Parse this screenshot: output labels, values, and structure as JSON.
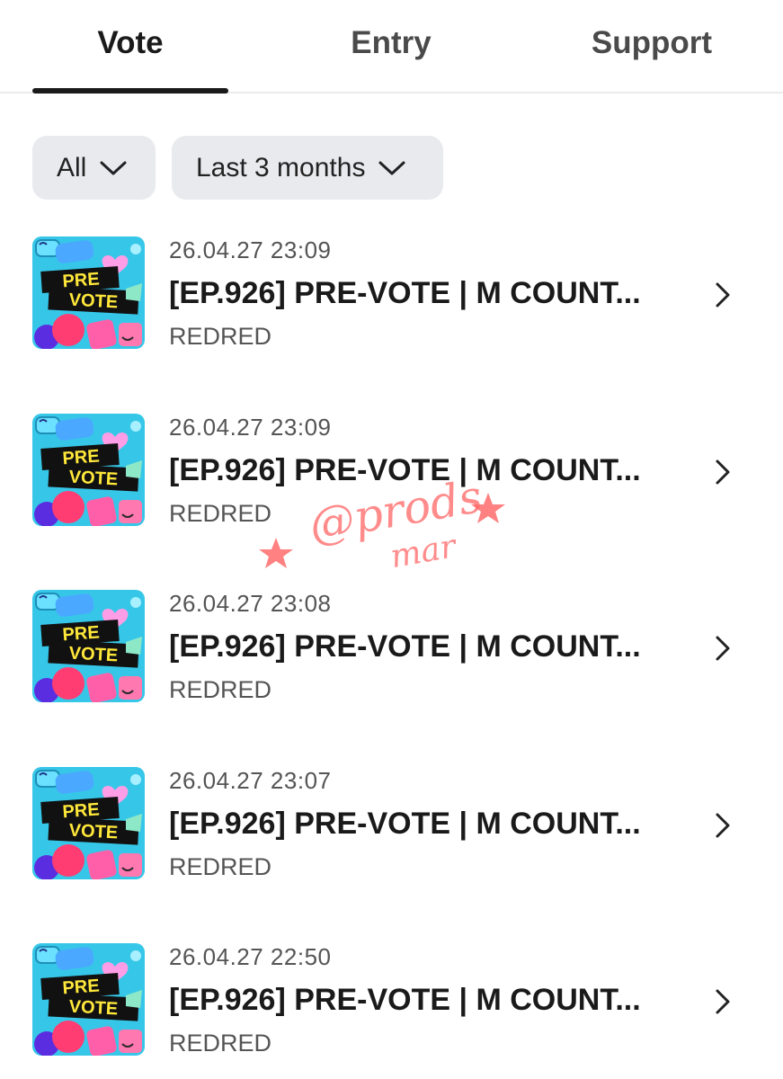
{
  "tabs": [
    {
      "label": "Vote",
      "active": true
    },
    {
      "label": "Entry",
      "active": false
    },
    {
      "label": "Support",
      "active": false
    }
  ],
  "filters": {
    "category": "All",
    "period": "Last 3 months"
  },
  "thumbnail": {
    "line1": "PRE",
    "line2": "VOTE",
    "bg_color": "#36c7e8",
    "banner_color": "#1a1a1a",
    "text_color": "#ffe83a"
  },
  "items": [
    {
      "date": "26.04.27 23:09",
      "title": "[EP.926] PRE-VOTE | M COUNT...",
      "artist": "REDRED"
    },
    {
      "date": "26.04.27 23:09",
      "title": "[EP.926] PRE-VOTE | M COUNT...",
      "artist": "REDRED"
    },
    {
      "date": "26.04.27 23:08",
      "title": "[EP.926] PRE-VOTE | M COUNT...",
      "artist": "REDRED"
    },
    {
      "date": "26.04.27 23:07",
      "title": "[EP.926] PRE-VOTE | M COUNT...",
      "artist": "REDRED"
    },
    {
      "date": "26.04.27 22:50",
      "title": "[EP.926] PRE-VOTE | M COUNT...",
      "artist": "REDRED"
    }
  ],
  "watermark": {
    "line1": "@prods",
    "line2": "mar",
    "color": "#ff6b6b"
  },
  "icons": {
    "dropdown": "chevron-down-icon",
    "row_arrow": "chevron-right-icon"
  }
}
